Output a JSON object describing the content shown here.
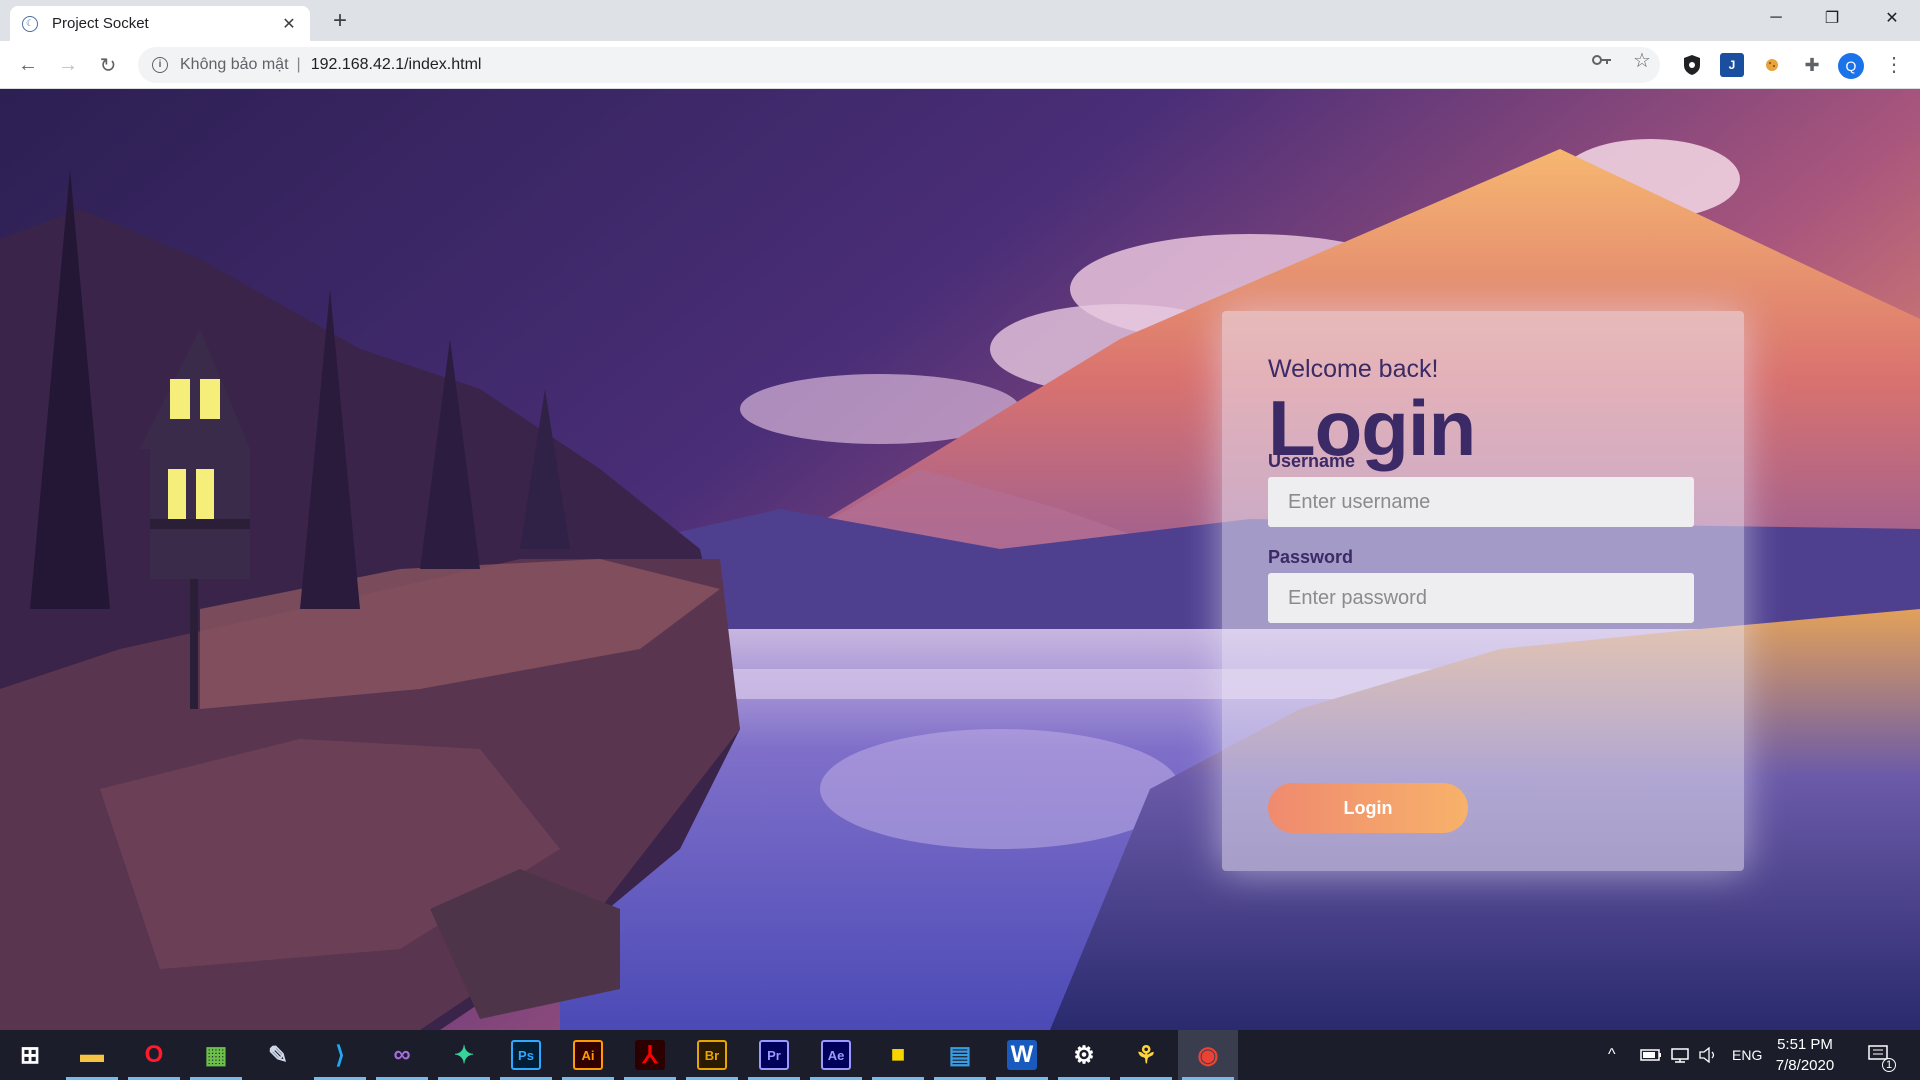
{
  "browser": {
    "tab_title": "Project Socket",
    "close_tab": "✕",
    "new_tab": "+",
    "window_controls": {
      "minimize": "─",
      "maximize": "❐",
      "close": "✕"
    },
    "nav": {
      "back": "←",
      "forward": "→",
      "reload": "↻"
    },
    "security_label": "Không bảo mật",
    "separator": "|",
    "url": "192.168.42.1/index.html",
    "profile_initial": "Q",
    "menu": "⋮"
  },
  "login": {
    "welcome": "Welcome back!",
    "title": "Login",
    "username_label": "Username",
    "username_placeholder": "Enter username",
    "password_label": "Password",
    "password_placeholder": "Enter password",
    "button_label": "Login"
  },
  "taskbar": {
    "apps": [
      {
        "name": "windows-start",
        "glyph": "⊞",
        "color": "#ffffff",
        "bg": "transparent"
      },
      {
        "name": "file-explorer",
        "glyph": "▬",
        "color": "#f6c344",
        "bg": "transparent"
      },
      {
        "name": "opera",
        "glyph": "O",
        "color": "#ff1b2d",
        "bg": "transparent"
      },
      {
        "name": "image-viewer",
        "glyph": "▦",
        "color": "#6cc04a",
        "bg": "transparent"
      },
      {
        "name": "notepad",
        "glyph": "✎",
        "color": "#cfd8e8",
        "bg": "transparent"
      },
      {
        "name": "vscode",
        "glyph": "⟩",
        "color": "#23a7f2",
        "bg": "transparent"
      },
      {
        "name": "visual-studio",
        "glyph": "∞",
        "color": "#a46ee0",
        "bg": "transparent"
      },
      {
        "name": "gitkraken",
        "glyph": "✦",
        "color": "#36d39a",
        "bg": "transparent"
      },
      {
        "name": "photoshop",
        "glyph": "Ps",
        "color": "#31a8ff",
        "bg": "#001e36"
      },
      {
        "name": "illustrator",
        "glyph": "Ai",
        "color": "#ff9a00",
        "bg": "#330000"
      },
      {
        "name": "acrobat",
        "glyph": "⅄",
        "color": "#ff0000",
        "bg": "#2b0000"
      },
      {
        "name": "bridge",
        "glyph": "Br",
        "color": "#e8a400",
        "bg": "#2a1a00"
      },
      {
        "name": "premiere",
        "glyph": "Pr",
        "color": "#9999ff",
        "bg": "#00005b"
      },
      {
        "name": "after-effects",
        "glyph": "Ae",
        "color": "#9999ff",
        "bg": "#00005b"
      },
      {
        "name": "sticky-notes",
        "glyph": "■",
        "color": "#f7d400",
        "bg": "transparent"
      },
      {
        "name": "outlook-contacts",
        "glyph": "▤",
        "color": "#3c9ce0",
        "bg": "transparent"
      },
      {
        "name": "word",
        "glyph": "W",
        "color": "#ffffff",
        "bg": "#185abd"
      },
      {
        "name": "settings",
        "glyph": "⚙",
        "color": "#ffffff",
        "bg": "transparent"
      },
      {
        "name": "python",
        "glyph": "⚘",
        "color": "#ffd43b",
        "bg": "transparent"
      },
      {
        "name": "chrome",
        "glyph": "◉",
        "color": "#ea4335",
        "bg": "transparent"
      }
    ],
    "tray": {
      "chevron": "^",
      "battery": "▭",
      "network": "⌸",
      "volume": "🔊",
      "language": "ENG",
      "time": "5:51 PM",
      "date": "7/8/2020",
      "notifications": "1"
    }
  },
  "colors": {
    "accent_text": "#3b2a66",
    "button_start": "#ef8a6f",
    "button_end": "#f7b26a"
  }
}
